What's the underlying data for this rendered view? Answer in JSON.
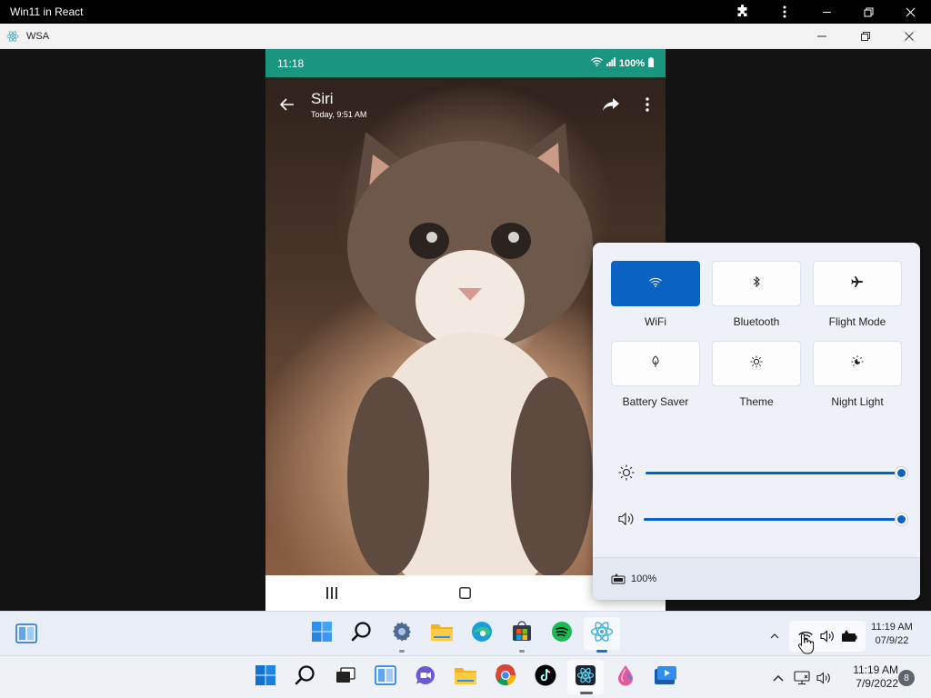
{
  "browser": {
    "title": "Win11 in React"
  },
  "window": {
    "title": "WSA"
  },
  "phone": {
    "time": "11:18",
    "battery": "100%",
    "contact_name": "Siri",
    "date": "Today, 9:51 AM"
  },
  "quick_settings": {
    "tiles": [
      {
        "label": "WiFi",
        "active": true
      },
      {
        "label": "Bluetooth",
        "active": false
      },
      {
        "label": "Flight Mode",
        "active": false
      },
      {
        "label": "Battery Saver",
        "active": false
      },
      {
        "label": "Theme",
        "active": false
      },
      {
        "label": "Night Light",
        "active": false
      }
    ],
    "brightness": 100,
    "volume": 100,
    "battery_label": "100%"
  },
  "inner_taskbar": {
    "time": "11:19 AM",
    "date": "07/9/22",
    "apps": [
      "windows-start",
      "search",
      "settings",
      "file-explorer",
      "edge",
      "store",
      "spotify",
      "react"
    ]
  },
  "host_taskbar": {
    "time": "11:19 AM",
    "date": "7/9/2022",
    "notification_count": "8"
  },
  "colors": {
    "accent": "#0a62c2",
    "status_bar": "#1a9680"
  }
}
